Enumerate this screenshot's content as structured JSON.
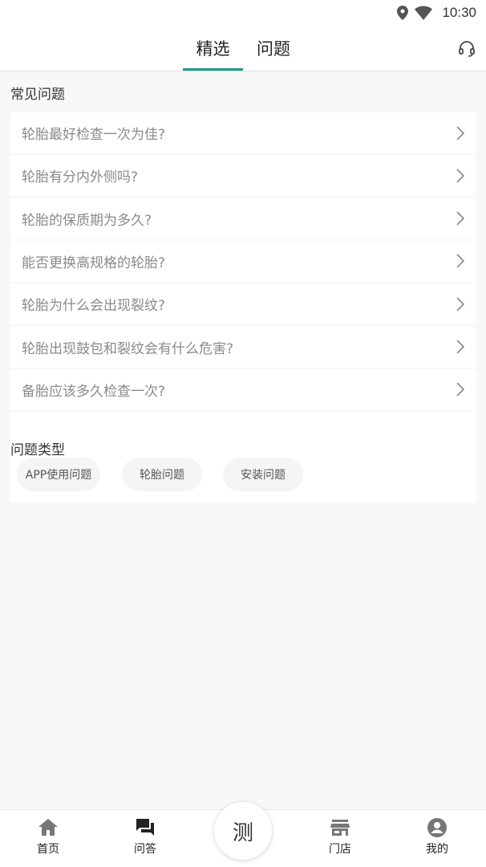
{
  "status_bar": {
    "time": "10:30"
  },
  "tabs": [
    {
      "label": "精选",
      "active": true
    },
    {
      "label": "问题",
      "active": false
    }
  ],
  "accent_color": "#1a9a8a",
  "common_questions": {
    "title": "常见问题",
    "items": [
      "轮胎最好检查一次为佳?",
      "轮胎有分内外侧吗?",
      "轮胎的保质期为多久?",
      "能否更换高规格的轮胎?",
      "轮胎为什么会出现裂纹?",
      "轮胎出现鼓包和裂纹会有什么危害?",
      "备胎应该多久检查一次?"
    ]
  },
  "question_types": {
    "title": "问题类型",
    "chips": [
      "APP使用问题",
      "轮胎问题",
      "安装问题"
    ]
  },
  "bottom_nav": {
    "home": {
      "label": "首页",
      "icon": "home-icon"
    },
    "qa": {
      "label": "问答",
      "icon": "forum-icon",
      "active": true
    },
    "center": {
      "label": "测"
    },
    "store": {
      "label": "门店",
      "icon": "store-icon"
    },
    "mine": {
      "label": "我的",
      "icon": "account-icon"
    }
  }
}
